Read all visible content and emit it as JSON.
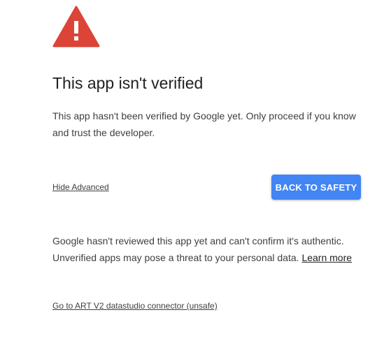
{
  "warning": {
    "icon": "warning-triangle-icon",
    "triangle_color": "#db4437",
    "mark_color": "#ffffff"
  },
  "title": "This app isn't verified",
  "description": "This app hasn't been verified by Google yet. Only proceed if you know and trust the developer.",
  "actions": {
    "hide_advanced_label": "Hide Advanced",
    "back_to_safety_label": "BACK TO SAFETY",
    "button_color": "#4285f4"
  },
  "advanced": {
    "text": "Google hasn't reviewed this app yet and can't confirm it's authentic. Unverified apps may pose a threat to your personal data.",
    "learn_more_label": "Learn more",
    "unsafe_link_label": "Go to ART V2 datastudio connector (unsafe)"
  }
}
